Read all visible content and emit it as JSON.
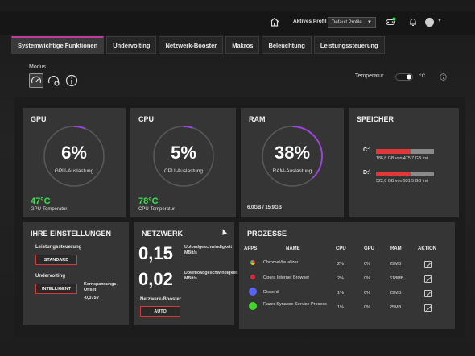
{
  "header": {
    "aktives_profil_label": "Aktives Profil",
    "profile_value": "Default Profile"
  },
  "tabs": [
    {
      "label": "Systemwichtige Funktionen",
      "active": true
    },
    {
      "label": "Undervolting",
      "active": false
    },
    {
      "label": "Netzwerk-Booster",
      "active": false
    },
    {
      "label": "Makros",
      "active": false
    },
    {
      "label": "Beleuchtung",
      "active": false
    },
    {
      "label": "Leistungssteuerung",
      "active": false
    }
  ],
  "modus": {
    "label": "Modus",
    "buttons": [
      "gauge-icon",
      "gauge-gear-icon",
      "info-icon"
    ]
  },
  "temperature": {
    "label": "Temperatur",
    "unit": "°C"
  },
  "gpu": {
    "title": "GPU",
    "usage_value": "6%",
    "usage_fraction": 0.06,
    "usage_label": "GPU-Auslastung",
    "temp_value": "47°C",
    "temp_label": "GPU-Temperatur"
  },
  "cpu": {
    "title": "CPU",
    "usage_value": "5%",
    "usage_fraction": 0.05,
    "usage_label": "CPU-Auslastung",
    "temp_value": "78°C",
    "temp_label": "CPU-Temperatur"
  },
  "ram": {
    "title": "RAM",
    "usage_value": "38%",
    "usage_fraction": 0.38,
    "usage_label": "RAM-Auslastung",
    "usage_text": "6.0GB / 15.9GB"
  },
  "storage": {
    "title": "SPEICHER",
    "drives": [
      {
        "letter": "C:\\",
        "fill_fraction": 0.6,
        "text": "186,8 GB von 475,7 GB frei"
      },
      {
        "letter": "D:\\",
        "fill_fraction": 0.6,
        "text": "522,6 GB von 931,5 GB frei"
      }
    ]
  },
  "settings": {
    "title": "IHRE EINSTELLUNGEN",
    "leistungssteuerung_label": "Leistungssteuerung",
    "leistungssteuerung_value": "STANDARD",
    "undervolting_label": "Undervolting",
    "undervolting_value": "INTELLIGENT",
    "offset_label": "Kernspannungs-Offset",
    "offset_value": "-0,075v"
  },
  "network": {
    "title": "NETZWERK",
    "upload_value": "0,15",
    "upload_label": "Uploadgeschwindigkeit MBit/s",
    "download_value": "0,02",
    "download_label": "Downloadgeschwindigkeit MBit/s",
    "booster_label": "Netzwerk-Booster",
    "booster_value": "AUTO"
  },
  "processes": {
    "title": "PROZESSE",
    "columns": [
      "APPS",
      "NAME",
      "CPU",
      "GPU",
      "RAM",
      "AKTION"
    ],
    "rows": [
      {
        "icon": "chrome-icon",
        "name": "ChromeVisualizer",
        "cpu": "2%",
        "gpu": "0%",
        "ram": "29MB"
      },
      {
        "icon": "opera-icon",
        "name": "Opera Internet Browser",
        "cpu": "2%",
        "gpu": "0%",
        "ram": "618MB"
      },
      {
        "icon": "discord-icon",
        "name": "Discord",
        "cpu": "1%",
        "gpu": "0%",
        "ram": "29MB"
      },
      {
        "icon": "razer-icon",
        "name": "Razer Synapse Service Process",
        "cpu": "1%",
        "gpu": "0%",
        "ram": "25MB"
      }
    ]
  },
  "colors": {
    "accent": "#c23aa0",
    "ring_gradient_start": "#b040d0",
    "ring_gradient_end": "#7a3fd8",
    "temp_green": "#3be04c",
    "alert_red": "#e03838"
  }
}
